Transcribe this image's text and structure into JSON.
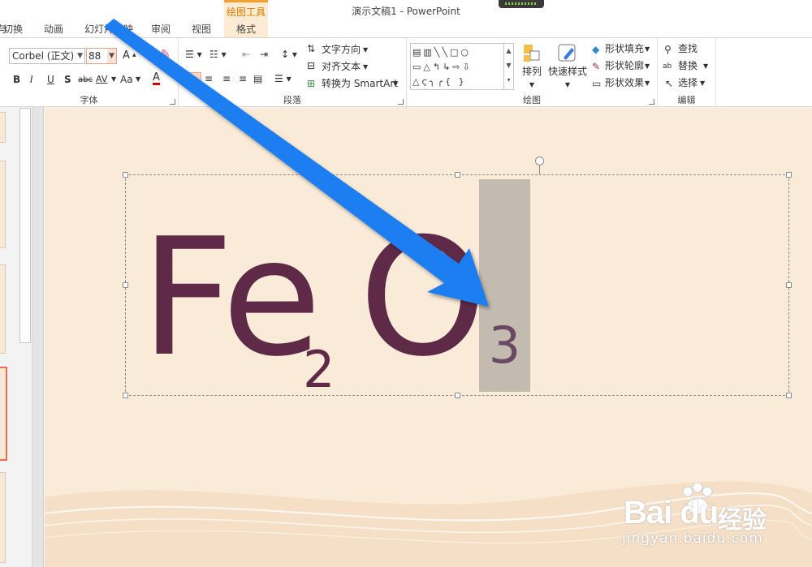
{
  "app": {
    "title": "演示文稿1 - PowerPoint"
  },
  "tabs": {
    "partial_left": "与",
    "items": [
      "切换",
      "动画",
      "幻灯片放映",
      "审阅",
      "视图"
    ],
    "contextual_group": "绘图工具",
    "contextual_tab": "格式"
  },
  "ribbon": {
    "font": {
      "name": "Corbel (正文)",
      "size": "88",
      "group_label": "字体",
      "bold": "B",
      "italic": "I",
      "underline": "U",
      "shadow": "S",
      "strike": "abc",
      "spacing": "AV",
      "case": "Aa",
      "grow": "A",
      "color": "A"
    },
    "paragraph": {
      "group_label": "段落",
      "text_direction": "文字方向",
      "align_text": "对齐文本",
      "smartart": "转换为 SmartArt"
    },
    "drawing": {
      "group_label": "绘图",
      "arrange": "排列",
      "quick_styles": "快速样式",
      "shape_fill": "形状填充",
      "shape_outline": "形状轮廓",
      "shape_effects": "形状效果"
    },
    "editing": {
      "group_label": "编辑",
      "find": "查找",
      "replace": "替换",
      "select": "选择"
    }
  },
  "slide": {
    "text_main": "Fe",
    "sub_two": "2",
    "text_o": "O",
    "sub_three": "3"
  },
  "colors": {
    "accent": "#f5a030",
    "text": "#5e2a48",
    "arrow": "#1e7ef0",
    "slide_bg": "#f9ebd7"
  },
  "watermark": {
    "brand": "Bai du",
    "cn": "经验",
    "url": "jingyan.baidu.com"
  }
}
